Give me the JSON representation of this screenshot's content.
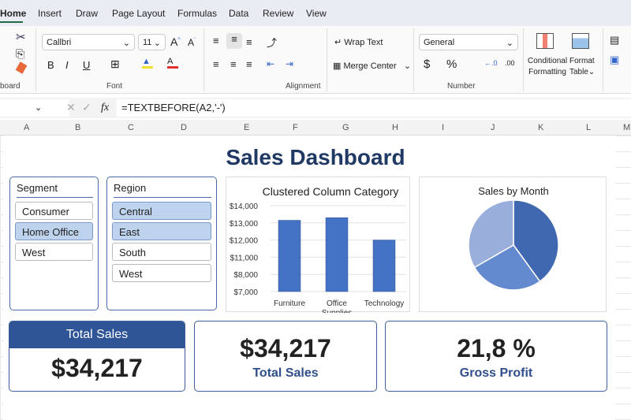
{
  "tabs": [
    "Home",
    "Insert",
    "Draw",
    "Page Layout",
    "Formulas",
    "Data",
    "Review",
    "View"
  ],
  "ribbon": {
    "font_name": "Callbri",
    "font_size": "11",
    "groups": {
      "clipboard": "board",
      "font": "Font",
      "alignment": "Alignment",
      "number": "Number"
    },
    "wrap_text": "Wrap Text",
    "merge_center": "Merge Center",
    "number_format": "General",
    "dollar": "$",
    "percent": "%",
    "conditional_formatting": [
      "Conditional",
      "Formatting"
    ],
    "format_table": [
      "Format",
      "Table"
    ],
    "bold": "B",
    "italic": "I",
    "underline": "U"
  },
  "formula_bar": {
    "fx": "fx",
    "formula": "=TEXTBEFORE(A2,'-')"
  },
  "columns": [
    "A",
    "B",
    "C",
    "D",
    "E",
    "F",
    "G",
    "H",
    "I",
    "J",
    "K",
    "L",
    "M"
  ],
  "dashboard": {
    "title": "Sales Dashboard",
    "segment": {
      "title": "Segment",
      "items": [
        {
          "label": "Consumer",
          "selected": false
        },
        {
          "label": "Home Office",
          "selected": true
        },
        {
          "label": "West",
          "selected": false
        }
      ]
    },
    "region": {
      "title": "Region",
      "items": [
        {
          "label": "Central",
          "selected": true
        },
        {
          "label": "East",
          "selected": true
        },
        {
          "label": "South",
          "selected": false
        },
        {
          "label": "West",
          "selected": false
        }
      ]
    },
    "kpis": [
      {
        "header": "Total Sales",
        "value": "$34,217"
      },
      {
        "value": "$34,217",
        "label": "Total Sales"
      },
      {
        "value": "21,8 %",
        "label": "Gross Profit"
      }
    ]
  },
  "chart_data": [
    {
      "type": "bar",
      "title": "Clustered Column Category",
      "categories": [
        "Furniture",
        "Office Supplies",
        "Technology"
      ],
      "values": [
        13150,
        13300,
        12000
      ],
      "ytick_labels": [
        "$14,000",
        "$13,000",
        "$12,000",
        "$11,000",
        "$8,000",
        "$7,000"
      ],
      "ytick_values": [
        14000,
        13000,
        12000,
        11000,
        8000,
        7000
      ],
      "color": "#4472c4",
      "grid": true
    },
    {
      "type": "pie",
      "title": "Sales by Month",
      "values": [
        40,
        26.7,
        33.3
      ],
      "colors": [
        "#4068b0",
        "#6389cf",
        "#9aaedc"
      ]
    }
  ]
}
